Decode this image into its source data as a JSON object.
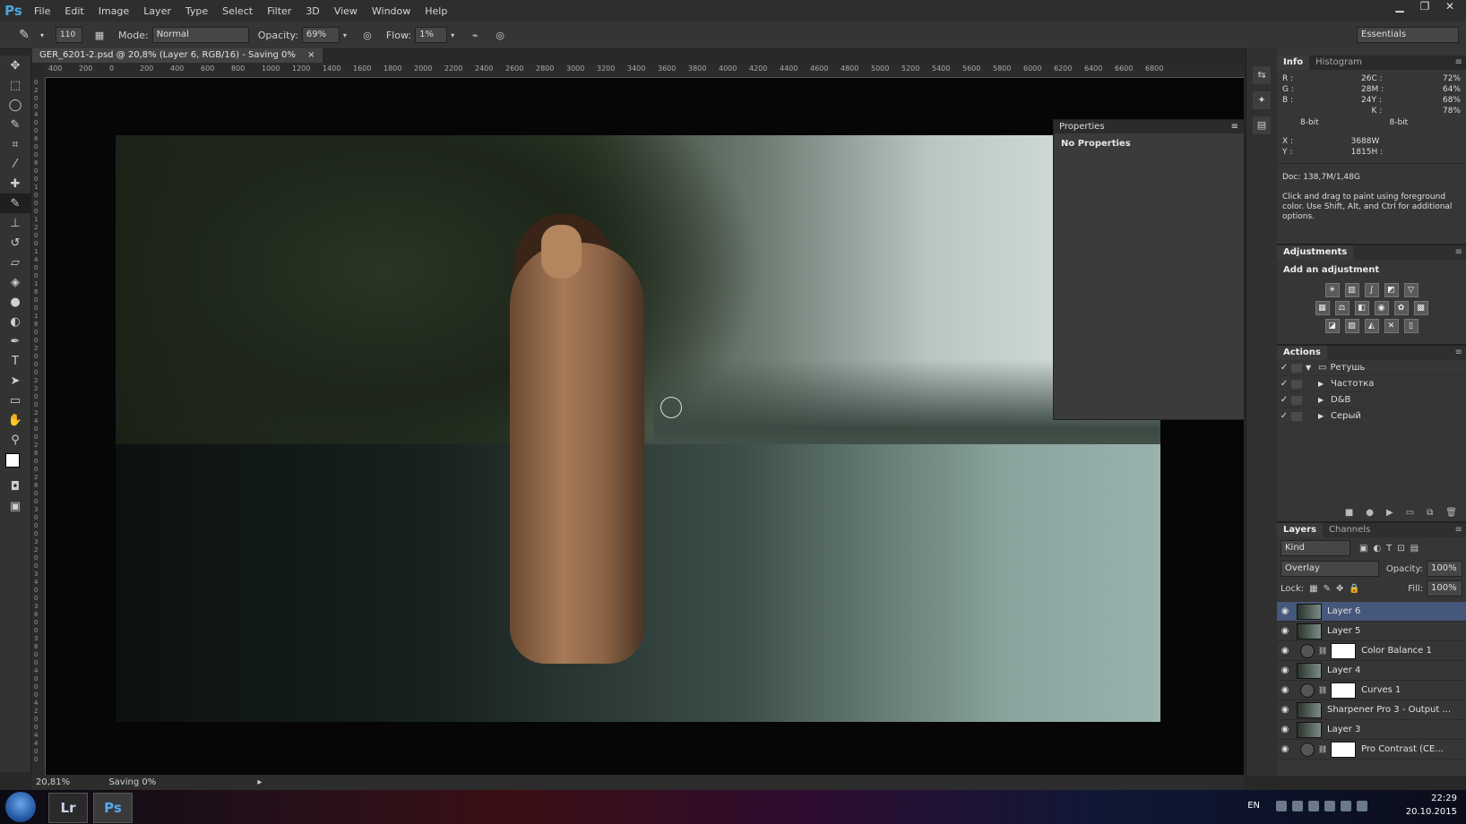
{
  "app": {
    "logo": "Ps"
  },
  "menu": [
    "File",
    "Edit",
    "Image",
    "Layer",
    "Type",
    "Select",
    "Filter",
    "3D",
    "View",
    "Window",
    "Help"
  ],
  "window_buttons": {
    "minimize": "▁",
    "restore": "❐",
    "close": "✕"
  },
  "options": {
    "brush_size": "110",
    "mode_label": "Mode:",
    "mode_value": "Normal",
    "opacity_label": "Opacity:",
    "opacity_value": "69%",
    "flow_label": "Flow:",
    "flow_value": "1%",
    "workspace": "Essentials"
  },
  "document": {
    "tab_title": "GER_6201-2.psd @ 20,8% (Layer 6, RGB/16) - Saving 0%",
    "close": "×"
  },
  "ruler_top": [
    "400",
    "200",
    "0",
    "200",
    "400",
    "600",
    "800",
    "1000",
    "1200",
    "1400",
    "1600",
    "1800",
    "2000",
    "2200",
    "2400",
    "2600",
    "2800",
    "3000",
    "3200",
    "3400",
    "3600",
    "3800",
    "4000",
    "4200",
    "4400",
    "4600",
    "4800",
    "5000",
    "5200",
    "5400",
    "5600",
    "5800",
    "6000",
    "6200",
    "6400",
    "6600",
    "6800"
  ],
  "ruler_left": [
    "0",
    "2",
    "0",
    "0",
    "4",
    "0",
    "0",
    "6",
    "0",
    "0",
    "8",
    "0",
    "0",
    "1",
    "0",
    "0",
    "0",
    "1",
    "2",
    "0",
    "0",
    "1",
    "4",
    "0",
    "0",
    "1",
    "6",
    "0",
    "0",
    "1",
    "8",
    "0",
    "0",
    "2",
    "0",
    "0",
    "0",
    "2",
    "2",
    "0",
    "0",
    "2",
    "4",
    "0",
    "0",
    "2",
    "6",
    "0",
    "0",
    "2",
    "8",
    "0",
    "0",
    "3",
    "0",
    "0",
    "0",
    "3",
    "2",
    "0",
    "0",
    "3",
    "4",
    "0",
    "0",
    "3",
    "6",
    "0",
    "0",
    "3",
    "8",
    "0",
    "0",
    "4",
    "0",
    "0",
    "0",
    "4",
    "2",
    "0",
    "0",
    "4",
    "4",
    "0",
    "0"
  ],
  "properties": {
    "title": "Properties",
    "body": "No Properties"
  },
  "status": {
    "zoom": "20,81%",
    "saving": "Saving 0%"
  },
  "info_panel": {
    "tabs": [
      "Info",
      "Histogram"
    ],
    "rgb": [
      {
        "l": "R :",
        "v": "26"
      },
      {
        "l": "G :",
        "v": "28"
      },
      {
        "l": "B :",
        "v": "24"
      }
    ],
    "cmyk": [
      {
        "l": "C :",
        "v": "72%"
      },
      {
        "l": "M :",
        "v": "64%"
      },
      {
        "l": "Y :",
        "v": "68%"
      },
      {
        "l": "K :",
        "v": "78%"
      }
    ],
    "bit_left": "8-bit",
    "bit_right": "8-bit",
    "xy": [
      {
        "l": "X :",
        "v": "3688"
      },
      {
        "l": "Y :",
        "v": "1815"
      }
    ],
    "wh": [
      {
        "l": "W :",
        "v": ""
      },
      {
        "l": "H :",
        "v": ""
      }
    ],
    "doc": "Doc: 138,7M/1,48G",
    "hint": "Click and drag to paint using foreground color. Use Shift, Alt, and Ctrl for additional options."
  },
  "adjustments": {
    "title": "Adjustments",
    "subtitle": "Add an adjustment"
  },
  "actions": {
    "title": "Actions",
    "items": [
      {
        "label": "Ретушь",
        "type": "set",
        "expanded": true
      },
      {
        "label": "Частотка",
        "type": "action"
      },
      {
        "label": "D&B",
        "type": "action"
      },
      {
        "label": "Серый",
        "type": "action"
      }
    ]
  },
  "layers_panel": {
    "tabs": [
      "Layers",
      "Channels"
    ],
    "kind": "Kind",
    "blend_mode": "Overlay",
    "opacity_label": "Opacity:",
    "opacity_value": "100%",
    "lock_label": "Lock:",
    "fill_label": "Fill:",
    "fill_value": "100%",
    "layers": [
      {
        "name": "Layer 6",
        "kind": "pixel",
        "selected": true
      },
      {
        "name": "Layer 5",
        "kind": "pixel"
      },
      {
        "name": "Color Balance 1",
        "kind": "adjustment"
      },
      {
        "name": "Layer 4",
        "kind": "pixel"
      },
      {
        "name": "Curves 1",
        "kind": "adjustment"
      },
      {
        "name": "Sharpener Pro 3 - Output ...",
        "kind": "pixel"
      },
      {
        "name": "Layer 3",
        "kind": "pixel"
      },
      {
        "name": "Pro Contrast (CE...",
        "kind": "adjustment"
      }
    ]
  },
  "taskbar": {
    "lang": "EN",
    "time": "22:29",
    "date": "20.10.2015",
    "apps": [
      "Lr",
      "Ps"
    ]
  }
}
